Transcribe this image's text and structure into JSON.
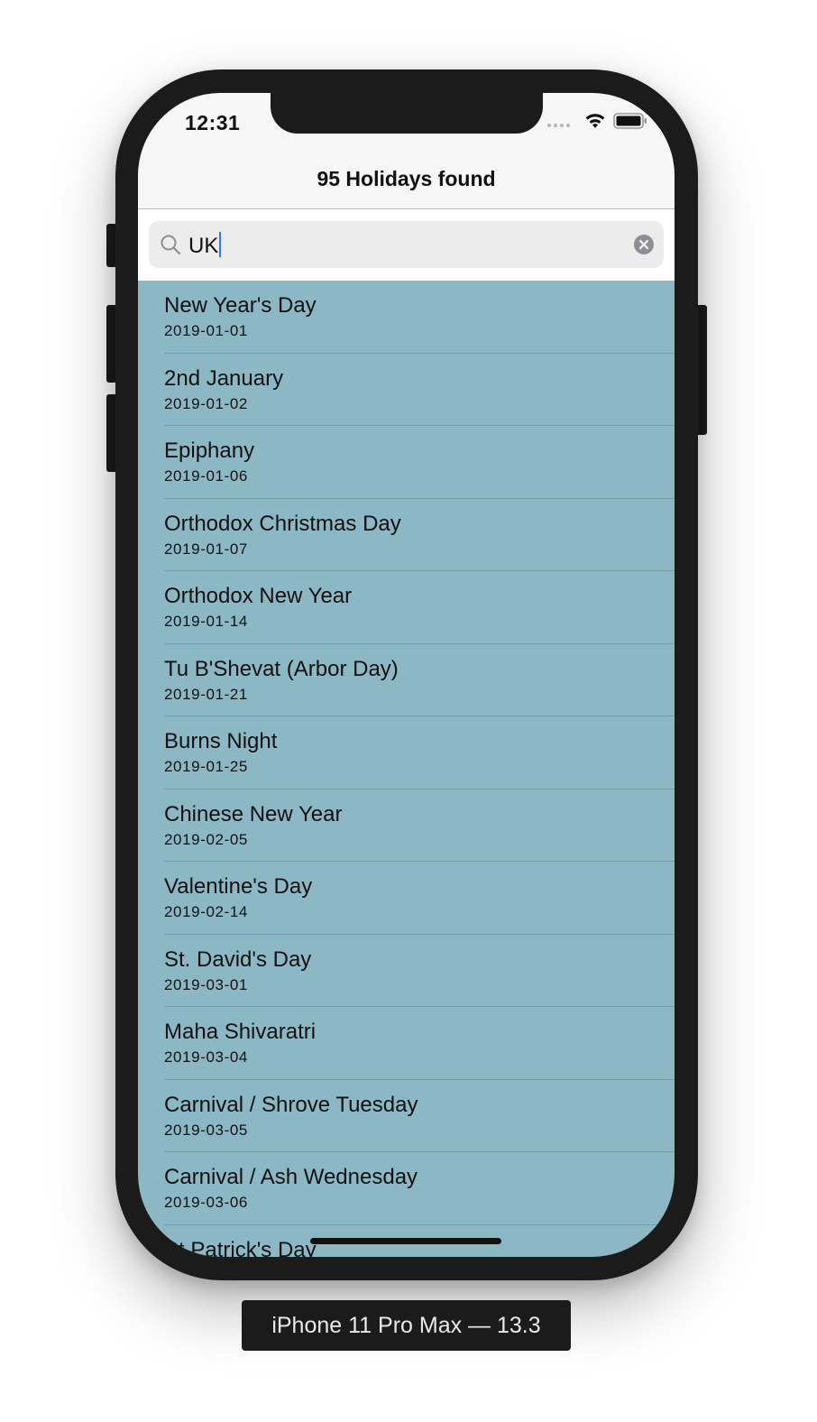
{
  "status_bar": {
    "time": "12:31",
    "icons": [
      "cellular-dots-icon",
      "wifi-icon",
      "battery-icon"
    ]
  },
  "nav_bar": {
    "title": "95 Holidays found"
  },
  "search": {
    "value": "UK",
    "icons": [
      "search-icon",
      "clear-icon"
    ]
  },
  "holidays": [
    {
      "name": "New Year's Day",
      "date": "2019-01-01"
    },
    {
      "name": "2nd January",
      "date": "2019-01-02"
    },
    {
      "name": "Epiphany",
      "date": "2019-01-06"
    },
    {
      "name": "Orthodox Christmas Day",
      "date": "2019-01-07"
    },
    {
      "name": "Orthodox New Year",
      "date": "2019-01-14"
    },
    {
      "name": "Tu B'Shevat (Arbor Day)",
      "date": "2019-01-21"
    },
    {
      "name": "Burns Night",
      "date": "2019-01-25"
    },
    {
      "name": "Chinese New Year",
      "date": "2019-02-05"
    },
    {
      "name": "Valentine's Day",
      "date": "2019-02-14"
    },
    {
      "name": "St. David's Day",
      "date": "2019-03-01"
    },
    {
      "name": "Maha Shivaratri",
      "date": "2019-03-04"
    },
    {
      "name": "Carnival / Shrove Tuesday",
      "date": "2019-03-05"
    },
    {
      "name": "Carnival / Ash Wednesday",
      "date": "2019-03-06"
    },
    {
      "name": "St Patrick's Day",
      "date": ""
    }
  ],
  "device_label": "iPhone 11 Pro Max — 13.3",
  "colors": {
    "list_background": "#8cb8c6",
    "nav_background": "#f6f6f6",
    "search_field": "#ececed",
    "device_frame": "#1b1b1b"
  }
}
